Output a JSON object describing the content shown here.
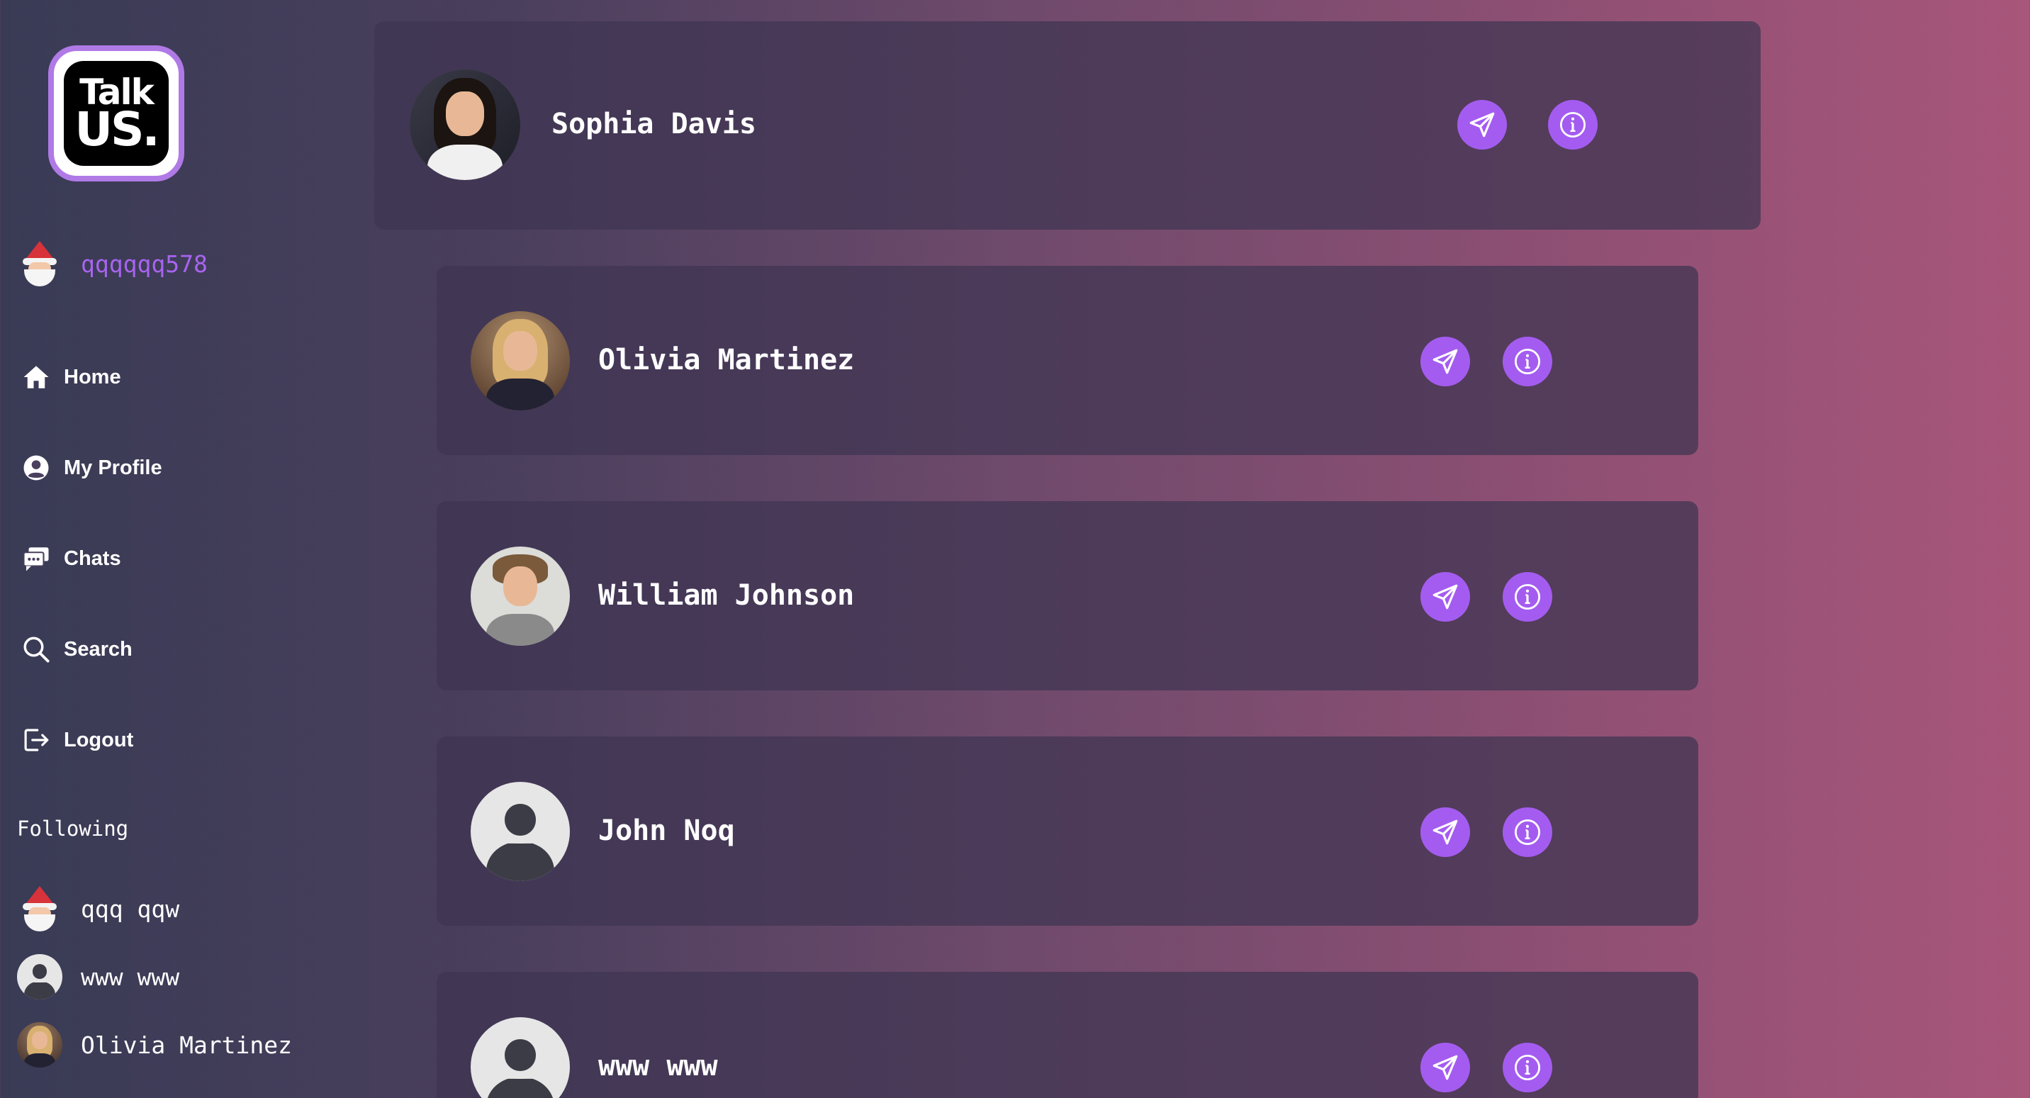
{
  "app": {
    "logo_line1": "Talk",
    "logo_line2": "US."
  },
  "current_user": {
    "username": "qqqqqq578",
    "avatar_icon": "santa-icon"
  },
  "nav": [
    {
      "label": "Home",
      "icon": "home-icon"
    },
    {
      "label": "My Profile",
      "icon": "profile-icon"
    },
    {
      "label": "Chats",
      "icon": "chats-icon"
    },
    {
      "label": "Search",
      "icon": "search-icon"
    },
    {
      "label": "Logout",
      "icon": "logout-icon"
    }
  ],
  "following": {
    "title": "Following",
    "items": [
      {
        "name": "qqq qqw",
        "avatar": "santa-icon"
      },
      {
        "name": "www www",
        "avatar": "default-avatar-icon"
      },
      {
        "name": "Olivia Martinez",
        "avatar": "photo"
      }
    ]
  },
  "users": [
    {
      "name": "Sophia Davis",
      "avatar": "photo"
    },
    {
      "name": "Olivia Martinez",
      "avatar": "photo"
    },
    {
      "name": "William Johnson",
      "avatar": "photo"
    },
    {
      "name": "John Noq",
      "avatar": "default-avatar-icon"
    },
    {
      "name": "www www",
      "avatar": "default-avatar-icon"
    }
  ],
  "colors": {
    "accent": "#a45cf0",
    "username": "#a864f0",
    "card_bg": "#3e3452"
  }
}
